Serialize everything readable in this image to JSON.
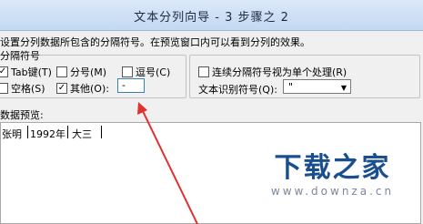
{
  "window": {
    "title": "文本分列向导 - 3 步骤之 2"
  },
  "intro_text": "设置分列数据所包含的分隔符号。在预览窗口内可以看到分列的效果。",
  "separators": {
    "caption": "分隔符号",
    "tab": {
      "label": "Tab键(T)",
      "checked": true
    },
    "semicolon": {
      "label": "分号(M)",
      "checked": false
    },
    "comma": {
      "label": "逗号(C)",
      "checked": false
    },
    "space": {
      "label": "空格(S)",
      "checked": false
    },
    "other": {
      "label": "其他(O):",
      "checked": true,
      "value": "-"
    }
  },
  "options": {
    "consecutive": {
      "label": "连续分隔符号视为单个处理(R)",
      "checked": false
    },
    "text_qualifier": {
      "label": "文本识别符号(Q):",
      "value": "\""
    }
  },
  "preview": {
    "caption": "数据预览:",
    "cells": [
      "张明",
      "1992年",
      "大三"
    ]
  },
  "watermark": {
    "main": "下载之家",
    "url": "www.downza.cn"
  },
  "colors": {
    "arrow": "#e03030",
    "watermark": "#1a4f8f"
  }
}
